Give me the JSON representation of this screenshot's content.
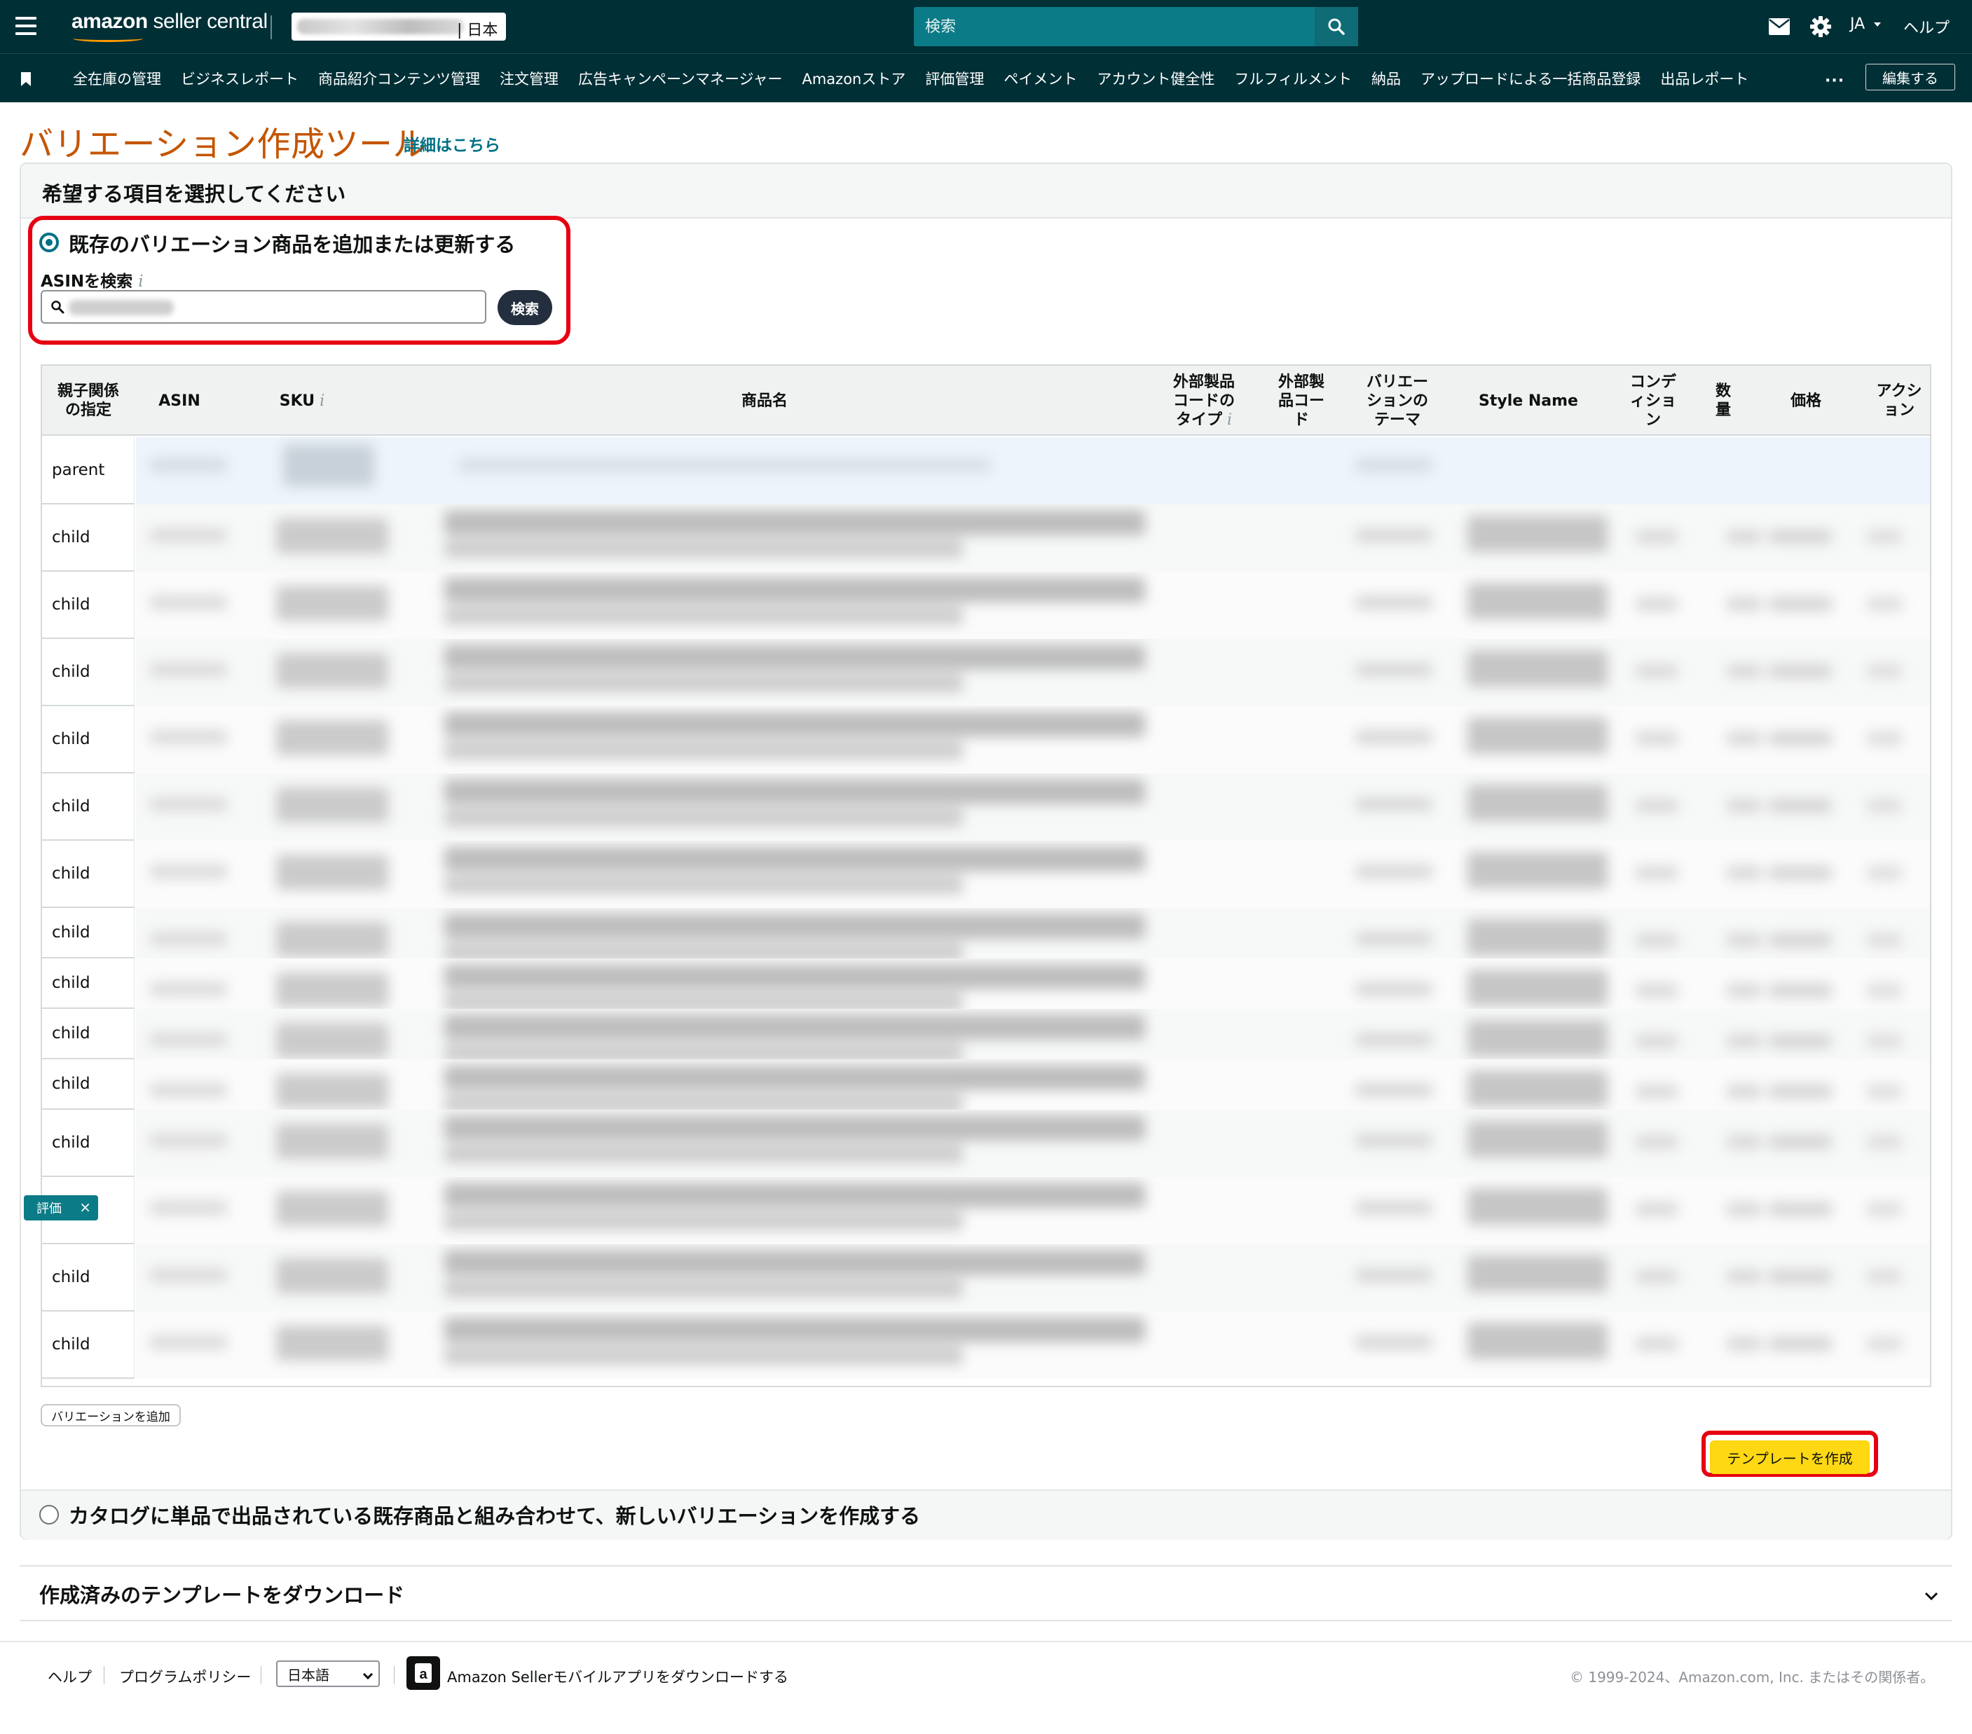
{
  "header": {
    "logo_bold": "amazon",
    "logo_rest": " seller central",
    "store_suffix": "| 日本",
    "search_placeholder": "検索",
    "language": "JA",
    "help": "ヘルプ",
    "icons": [
      "hamburger-icon",
      "search-icon",
      "mail-icon",
      "gear-icon",
      "chevron-down-icon"
    ]
  },
  "nav": {
    "items": [
      "全在庫の管理",
      "ビジネスレポート",
      "商品紹介コンテンツ管理",
      "注文管理",
      "広告キャンペーンマネージャー",
      "Amazonストア",
      "評価管理",
      "ペイメント",
      "アカウント健全性",
      "フルフィルメント",
      "納品",
      "アップロードによる一括商品登録",
      "出品レポート"
    ],
    "more": "···",
    "edit": "編集する"
  },
  "page": {
    "title": "バリエーション作成ツール",
    "details_link": "詳細はこちら",
    "panel_title": "希望する項目を選択してください",
    "option1": "既存のバリエーション商品を追加または更新する",
    "asin_label": "ASINを検索",
    "asin_search_button": "検索",
    "option2": "カタログに単品で出品されている既存商品と組み合わせて、新しいバリエーションを作成する",
    "add_variation": "バリエーションを追加",
    "create_template": "テンプレートを作成",
    "floating_tag": "評価",
    "floating_tag_close": "×"
  },
  "table": {
    "columns": [
      {
        "l1": "親子関係",
        "l2": "の指定",
        "l3": ""
      },
      {
        "l1": "ASIN",
        "l2": "",
        "l3": ""
      },
      {
        "l1": "SKU",
        "l2": "",
        "l3": "",
        "info": true
      },
      {
        "l1": "商品名",
        "l2": "",
        "l3": ""
      },
      {
        "l1": "外部製品",
        "l2": "コードの",
        "l3": "タイプ",
        "info": true
      },
      {
        "l1": "外部製",
        "l2": "品コー",
        "l3": "ド"
      },
      {
        "l1": "バリエー",
        "l2": "ションの",
        "l3": "テーマ"
      },
      {
        "l1": "Style Name",
        "l2": "",
        "l3": ""
      },
      {
        "l1": "コンデ",
        "l2": "ィショ",
        "l3": "ン"
      },
      {
        "l1": "数",
        "l2": "量",
        "l3": ""
      },
      {
        "l1": "価格",
        "l2": "",
        "l3": ""
      },
      {
        "l1": "アクシ",
        "l2": "ョン",
        "l3": ""
      }
    ],
    "rows": [
      "parent",
      "child",
      "child",
      "child",
      "child",
      "child",
      "child",
      "child",
      "child",
      "child",
      "child",
      "child",
      "",
      "child",
      "child"
    ]
  },
  "download": {
    "title": "作成済みのテンプレートをダウンロード"
  },
  "footer": {
    "help": "ヘルプ",
    "policy": "プログラムポリシー",
    "language": "日本語",
    "app_text": "Amazon Sellerモバイルアプリをダウンロードする",
    "copyright": "© 1999-2024、Amazon.com, Inc. またはその関係者。"
  },
  "colors": {
    "header_bg": "#002f36",
    "search_bg": "#0b7b87",
    "title_orange": "#c45500",
    "link_teal": "#007185",
    "highlight_red": "#e60012",
    "primary_yellow": "#ffd814"
  }
}
